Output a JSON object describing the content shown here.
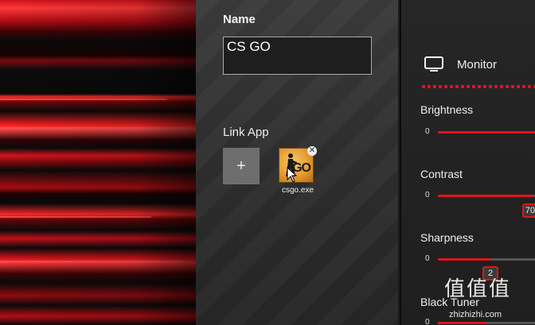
{
  "profile": {
    "name_label": "Name",
    "name_value": "CS GO",
    "link_app_label": "Link App",
    "add_app_symbol": "+",
    "linked_app": {
      "label": "csgo.exe",
      "icon_text": "GO",
      "remove_symbol": "✕",
      "icon": "csgo-icon"
    }
  },
  "monitor": {
    "title": "Monitor",
    "icon": "monitor-icon",
    "accent": "#e0141b",
    "settings": [
      {
        "label": "Brightness",
        "min": "0"
      },
      {
        "label": "Contrast",
        "min": "0",
        "value": "70"
      },
      {
        "label": "Sharpness",
        "min": "0",
        "value": "2"
      },
      {
        "label": "Black Tuner",
        "min": "0"
      }
    ]
  },
  "watermark": {
    "logo": "值",
    "url": "zhizhizhi.com"
  }
}
